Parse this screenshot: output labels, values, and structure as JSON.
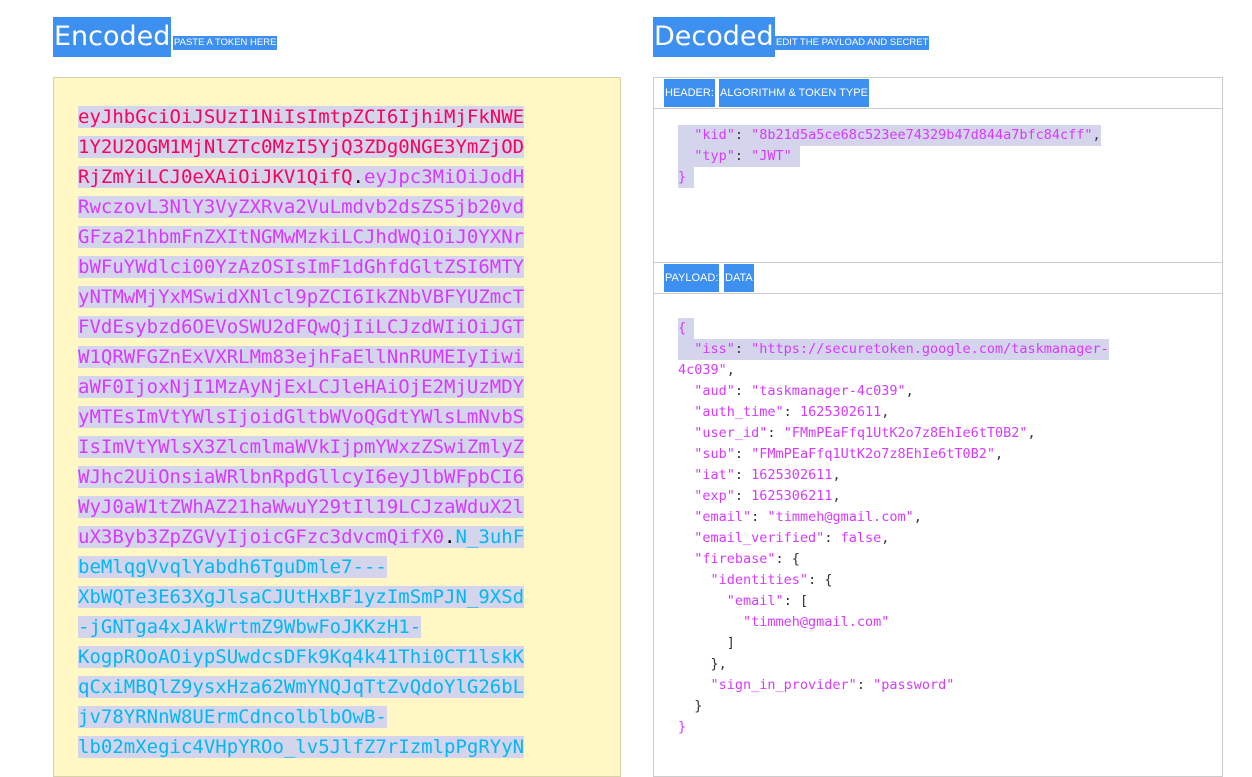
{
  "encoded": {
    "title": "Encoded",
    "subtitle": "PASTE A TOKEN HERE",
    "lines": [
      {
        "text": "eyJhbGciOiJSUzI1NiIsImtpZCI6IjhiMjFkNWE",
        "color": "h"
      },
      {
        "text": "1Y2U2OGM1MjNlZTc0MzI5YjQ3ZDg0NGE3YmZjOD",
        "color": "h"
      },
      {
        "text": "RjZmYiLCJ0eXAiOiJKV1QifQ",
        "color": "h",
        "dot": ".",
        "tail": "eyJpc3MiOiJodH",
        "tail_color": "p"
      },
      {
        "text": "RwczovL3NlY3VyZXRva2VuLmdvb2dsZS5jb20vd",
        "color": "p"
      },
      {
        "text": "GFza21hbmFnZXItNGMwMzkiLCJhdWQiOiJ0YXNr",
        "color": "p"
      },
      {
        "text": "bWFuYWdlci00YzAzOSIsImF1dGhfdGltZSI6MTY",
        "color": "p"
      },
      {
        "text": "yNTMwMjYxMSwidXNlcl9pZCI6IkZNbVBFYUZmcT",
        "color": "p"
      },
      {
        "text": "FVdEsybzd6OEVoSWU2dFQwQjIiLCJzdWIiOiJGT",
        "color": "p"
      },
      {
        "text": "W1QRWFGZnExVXRLMm83ejhFaEllNnRUMEIyIiwi",
        "color": "p"
      },
      {
        "text": "aWF0IjoxNjI1MzAyNjExLCJleHAiOjE2MjUzMDY",
        "color": "p"
      },
      {
        "text": "yMTEsImVtYWlsIjoidGltbWVoQGdtYWlsLmNvbS",
        "color": "p"
      },
      {
        "text": "IsImVtYWlsX3ZlcmlmaWVkIjpmYWxzZSwiZmlyZ",
        "color": "p"
      },
      {
        "text": "WJhc2UiOnsiaWRlbnRpdGllcyI6eyJlbWFpbCI6",
        "color": "p"
      },
      {
        "text": "WyJ0aW1tZWhAZ21haWwuY29tIl19LCJzaWduX2l",
        "color": "p"
      },
      {
        "text": "uX3Byb3ZpZGVyIjoicGFzc3dvcmQifX0",
        "color": "p",
        "dot": ".",
        "tail": "N_3uhF",
        "tail_color": "s"
      },
      {
        "text": "beMlqgVvqlYabdh6TguDmle7---",
        "color": "s"
      },
      {
        "text": "XbWQTe3E63XgJlsaCJUtHxBF1yzImSmPJN_9XSd",
        "color": "s"
      },
      {
        "text": "-jGNTga4xJAkWrtmZ9WbwFoJKKzH1-",
        "color": "s"
      },
      {
        "text": "KogpROoAOiypSUwdcsDFk9Kq4k41Thi0CT1lskK",
        "color": "s"
      },
      {
        "text": "qCxiMBQlZ9ysxHza62WmYNQJqTtZvQdoYlG26bL",
        "color": "s"
      },
      {
        "text": "jv78YRNnW8UErmCdncolblbOwB-",
        "color": "s"
      },
      {
        "text": "lb02mXegic4VHpYROo_lv5JlfZ7rIzmlpPgRYyN",
        "color": "s"
      }
    ]
  },
  "decoded": {
    "title": "Decoded",
    "subtitle": "EDIT THE PAYLOAD AND SECRET",
    "header_section": {
      "label_a": "HEADER:",
      "label_b": "ALGORITHM & TOKEN TYPE"
    },
    "payload_section": {
      "label_a": "PAYLOAD:",
      "label_b": "DATA"
    },
    "header_json": {
      "kid_key": "\"kid\"",
      "kid_val": "\"8b21d5a5ce68c523ee74329b47d844a7bfc84cff\"",
      "typ_key": "\"typ\"",
      "typ_val": "\"JWT\"",
      "close": "}"
    },
    "payload_json": {
      "open": "{",
      "iss_key": "\"iss\"",
      "iss_val_1": "\"https://securetoken.google.com/taskmanager-",
      "iss_val_2": "4c039\"",
      "aud_key": "\"aud\"",
      "aud_val": "\"taskmanager-4c039\"",
      "auth_time_key": "\"auth_time\"",
      "auth_time_val": "1625302611",
      "user_id_key": "\"user_id\"",
      "user_id_val": "\"FMmPEaFfq1UtK2o7z8EhIe6tT0B2\"",
      "sub_key": "\"sub\"",
      "sub_val": "\"FMmPEaFfq1UtK2o7z8EhIe6tT0B2\"",
      "iat_key": "\"iat\"",
      "iat_val": "1625302611",
      "exp_key": "\"exp\"",
      "exp_val": "1625306211",
      "email_key": "\"email\"",
      "email_val": "\"timmeh@gmail.com\"",
      "email_verified_key": "\"email_verified\"",
      "email_verified_val": "false",
      "firebase_key": "\"firebase\"",
      "identities_key": "\"identities\"",
      "identities_email_key": "\"email\"",
      "identities_email_val": "\"timmeh@gmail.com\"",
      "sign_in_provider_key": "\"sign_in_provider\"",
      "sign_in_provider_val": "\"password\"",
      "close": "}"
    }
  },
  "colors": {
    "header": "#fb015b",
    "payload": "#d63aff",
    "signature": "#00b9f1",
    "selection": "#3d8ff0",
    "highlight": "#fff200",
    "encoded_bg": "#fff8c5"
  }
}
